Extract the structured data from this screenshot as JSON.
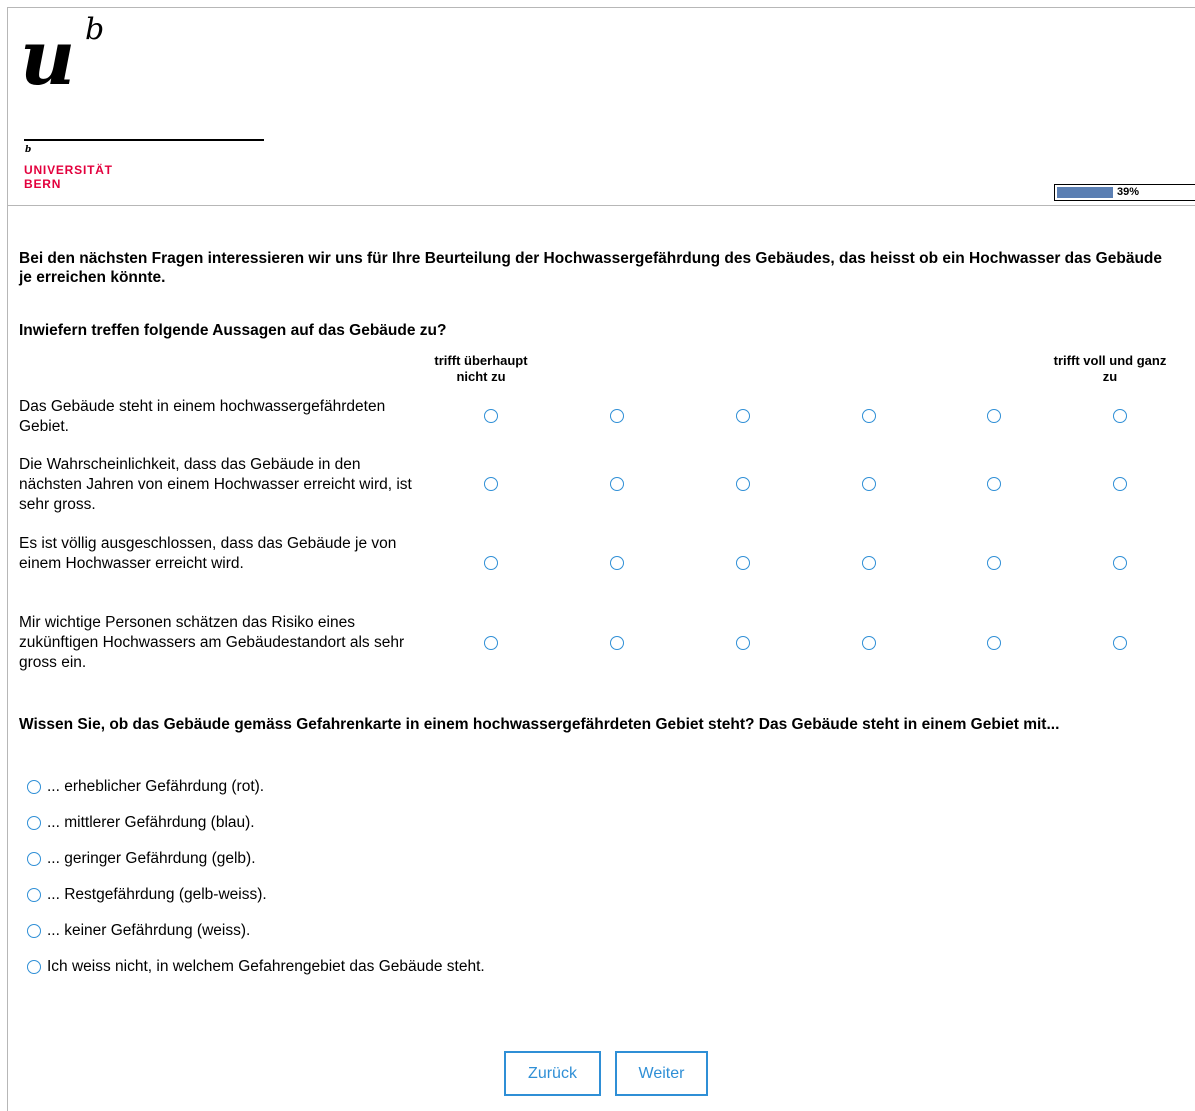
{
  "header": {
    "logo_u": "u",
    "logo_b": "b",
    "logo_small_b": "b",
    "logo_line1": "UNIVERSITÄT",
    "logo_line2": "BERN",
    "progress_text": "39%",
    "progress_value": 0.39,
    "brand_color": "#e3003d"
  },
  "intro": "Bei den nächsten Fragen interessieren wir uns für Ihre Beurteilung der Hochwassergefährdung des Gebäudes, das heisst ob ein Hochwasser das Gebäude je erreichen könnte.",
  "q1": {
    "title": "Inwiefern treffen folgende Aussagen auf das Gebäude zu?",
    "scale_left": "trifft überhaupt nicht zu",
    "scale_right": "trifft voll und ganz zu",
    "rows": [
      {
        "label": "Das Gebäude steht in einem hochwassergefährdeten Gebiet."
      },
      {
        "label": "Die Wahrscheinlichkeit, dass das Gebäude in den nächsten Jahren von einem Hochwasser erreicht wird, ist sehr gross."
      },
      {
        "label": "Es ist völlig ausgeschlossen, dass das Gebäude je von einem Hochwasser erreicht wird."
      },
      {
        "label": "Mir wichtige Personen schätzen das Risiko eines zukünftigen Hochwassers am Gebäudestandort als sehr gross ein."
      }
    ]
  },
  "q2": {
    "title": "Wissen Sie, ob das Gebäude gemäss Gefahrenkarte in einem hochwassergefährdeten Gebiet steht? Das Gebäude steht in einem Gebiet mit...",
    "options": [
      "... erheblicher Gefährdung (rot).",
      "... mittlerer Gefährdung (blau).",
      "... geringer Gefährdung (gelb).",
      "... Restgefährdung (gelb-weiss).",
      "... keiner Gefährdung (weiss).",
      "Ich weiss nicht, in welchem Gefahrengebiet das Gebäude steht."
    ]
  },
  "nav": {
    "back_label": "Zurück",
    "next_label": "Weiter",
    "accent_color": "#2f8fd6"
  }
}
